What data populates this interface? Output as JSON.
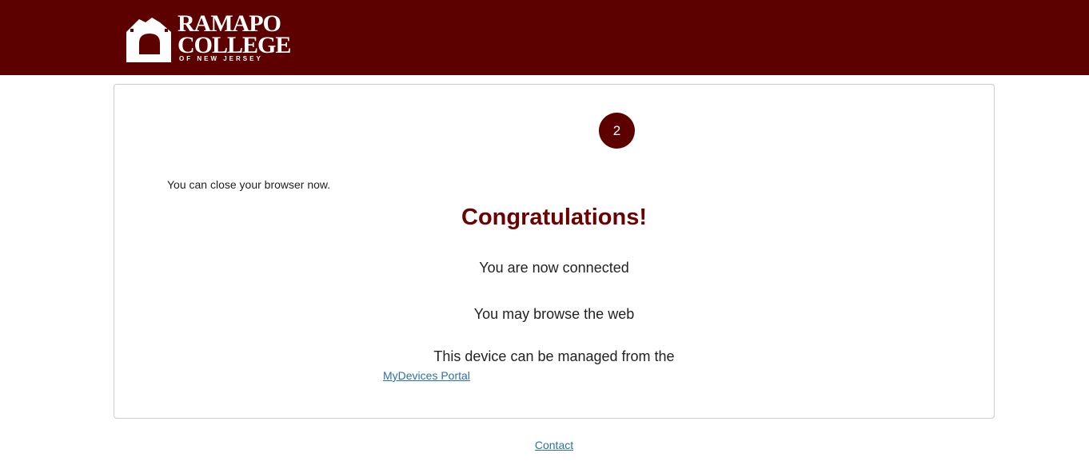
{
  "header": {
    "logo": {
      "name_line1": "RAMAPO",
      "name_line2": "COLLEGE",
      "tagline": "OF NEW JERSEY",
      "icon": "archway-logo-icon"
    },
    "background_color": "#5c0000"
  },
  "card": {
    "step_number": "2",
    "close_note": "You can close your browser now.",
    "title": "Congratulations!",
    "connected_text": "You are now connected",
    "browse_text": "You may browse the web",
    "managed_text": "This device can be managed from the",
    "portal_link": "MyDevices Portal"
  },
  "footer": {
    "contact_link": "Contact"
  },
  "colors": {
    "brand": "#5c0000",
    "title": "#6d0000",
    "link": "#2f6fa8"
  }
}
